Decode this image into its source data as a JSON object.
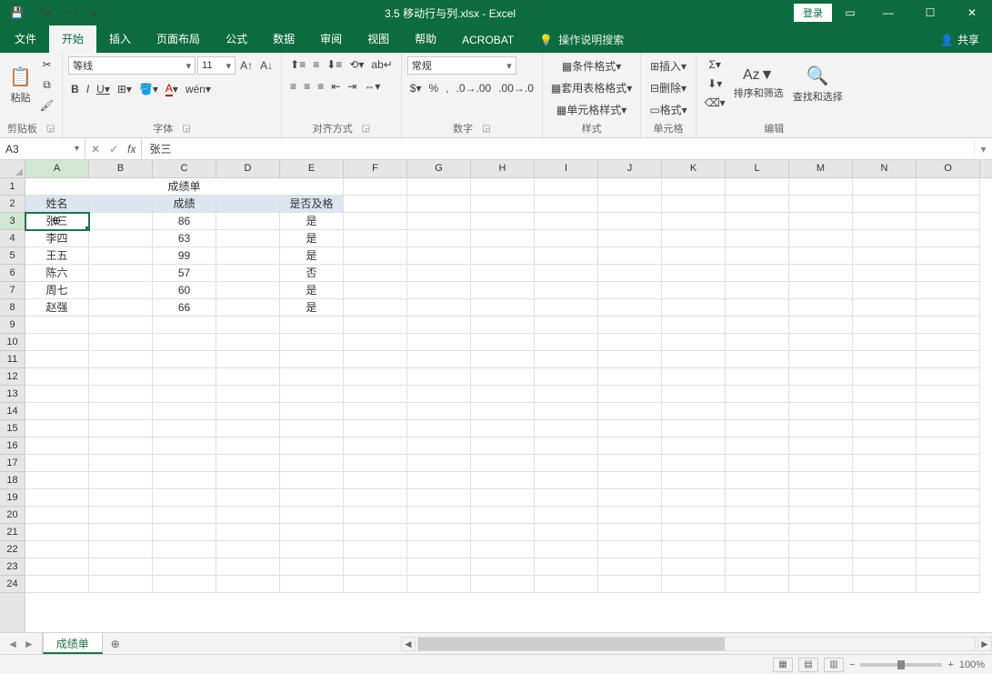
{
  "title": "3.5 移动行与列.xlsx - Excel",
  "login": "登录",
  "share": "共享",
  "tabs": {
    "file": "文件",
    "home": "开始",
    "insert": "插入",
    "layout": "页面布局",
    "formulas": "公式",
    "data": "数据",
    "review": "审阅",
    "view": "视图",
    "help": "帮助",
    "acrobat": "ACROBAT",
    "tell": "操作说明搜索"
  },
  "ribbon": {
    "clipboard": {
      "label": "剪贴板",
      "paste": "粘贴"
    },
    "font": {
      "label": "字体",
      "name": "等线",
      "size": "11",
      "bold": "B",
      "italic": "I",
      "underline": "U"
    },
    "alignment": {
      "label": "对齐方式"
    },
    "number": {
      "label": "数字",
      "format": "常规"
    },
    "styles": {
      "label": "样式",
      "cond": "条件格式",
      "tablefmt": "套用表格格式",
      "cellfmt": "单元格样式"
    },
    "cells": {
      "label": "单元格",
      "insert": "插入",
      "delete": "删除",
      "format": "格式"
    },
    "editing": {
      "label": "编辑",
      "sortfilter": "排序和筛选",
      "find": "查找和选择"
    }
  },
  "formula_bar": {
    "namebox": "A3",
    "formula": "张三"
  },
  "columns": [
    "A",
    "B",
    "C",
    "D",
    "E",
    "F",
    "G",
    "H",
    "I",
    "J",
    "K",
    "L",
    "M",
    "N",
    "O"
  ],
  "rowcount": 24,
  "sheet": {
    "title_row": "成绩单",
    "headers": [
      "姓名",
      "成绩",
      "是否及格"
    ],
    "header_cols": [
      "A",
      "C",
      "E"
    ],
    "rows": [
      {
        "A": "张三",
        "C": "86",
        "E": "是"
      },
      {
        "A": "李四",
        "C": "63",
        "E": "是"
      },
      {
        "A": "王五",
        "C": "99",
        "E": "是"
      },
      {
        "A": "陈六",
        "C": "57",
        "E": "否"
      },
      {
        "A": "周七",
        "C": "60",
        "E": "是"
      },
      {
        "A": "赵强",
        "C": "66",
        "E": "是"
      }
    ],
    "active_cell": "A3"
  },
  "tabs_bottom": {
    "sheet1": "成绩单"
  },
  "zoom": "100%"
}
